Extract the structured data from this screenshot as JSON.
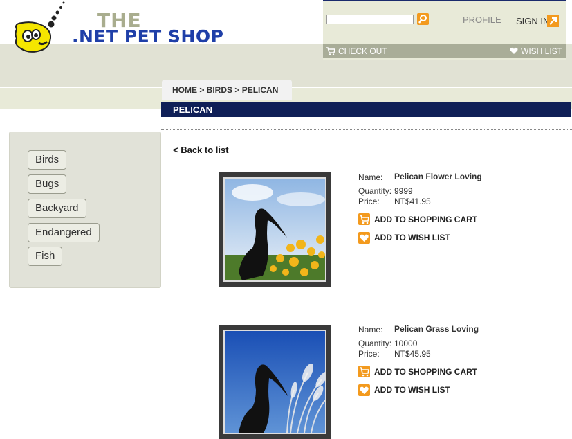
{
  "brand": {
    "line1": "THE",
    "line2": ".NET PET SHOP"
  },
  "header": {
    "search": {
      "value": "",
      "placeholder": ""
    },
    "profile_label": "PROFILE",
    "signin_label": "SIGN IN",
    "checkout_label": "CHECK OUT",
    "wishlist_label": "WISH LIST"
  },
  "breadcrumb": {
    "text": "HOME > BIRDS > PELICAN"
  },
  "page_title": "PELICAN",
  "sidebar": {
    "items": [
      {
        "label": "Birds"
      },
      {
        "label": "Bugs"
      },
      {
        "label": "Backyard"
      },
      {
        "label": "Endangered"
      },
      {
        "label": "Fish"
      }
    ]
  },
  "back_link": "< Back to list",
  "labels": {
    "name": "Name:",
    "quantity": "Quantity:",
    "price": "Price:"
  },
  "actions": {
    "add_cart": "ADD TO SHOPPING CART",
    "add_wish": "ADD TO WISH LIST"
  },
  "products": [
    {
      "name": "Pelican Flower Loving",
      "quantity": "9999",
      "price": "NT$41.95"
    },
    {
      "name": "Pelican Grass Loving",
      "quantity": "10000",
      "price": "NT$45.95"
    }
  ],
  "colors": {
    "accent": "#f39a1e",
    "navy": "#0f1f57",
    "band": "#e1e2d4"
  }
}
